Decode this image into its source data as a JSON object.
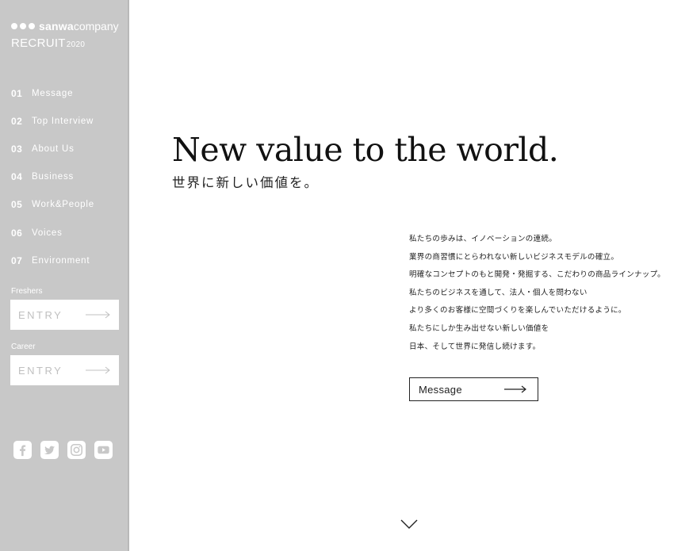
{
  "brand": {
    "name_bold": "sanwa",
    "name_light": "company",
    "recruit": "RECRUIT",
    "year": "2020"
  },
  "nav": [
    {
      "num": "01",
      "label": "Message"
    },
    {
      "num": "02",
      "label": "Top Interview"
    },
    {
      "num": "03",
      "label": "About Us"
    },
    {
      "num": "04",
      "label": "Business"
    },
    {
      "num": "05",
      "label": "Work&People"
    },
    {
      "num": "06",
      "label": "Voices"
    },
    {
      "num": "07",
      "label": "Environment"
    }
  ],
  "entries": {
    "freshers": {
      "label": "Freshers",
      "button": "ENTRY"
    },
    "career": {
      "label": "Career",
      "button": "ENTRY"
    }
  },
  "social": [
    "facebook-icon",
    "twitter-icon",
    "instagram-icon",
    "youtube-icon"
  ],
  "hero": {
    "headline": "New value to the world.",
    "subhead": "世界に新しい価値を。"
  },
  "body_lines": [
    "私たちの歩みは、イノベーションの連続。",
    "業界の商習慣にとらわれない新しいビジネスモデルの確立。",
    "明確なコンセプトのもと開発・発掘する、こだわりの商品ラインナップ。",
    "私たちのビジネスを通して、法人・個人を問わない",
    "より多くのお客様に空間づくりを楽しんでいただけるように。",
    "私たちにしか生み出せない新しい価値を",
    "日本、そして世界に発信し続けます。"
  ],
  "message_button": "Message",
  "colors": {
    "sidebar": "#c8c8c8",
    "text": "#222222",
    "entry_text": "#c0c0c0"
  }
}
